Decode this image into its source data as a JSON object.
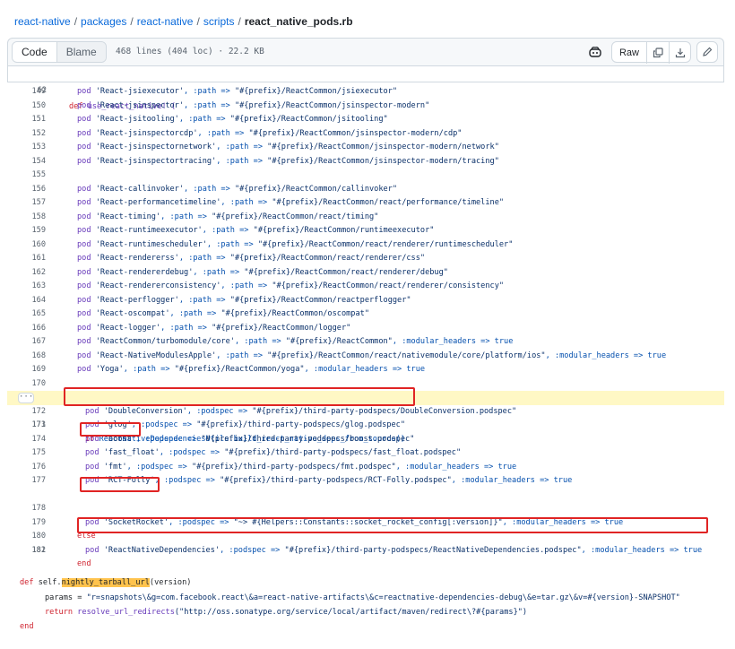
{
  "breadcrumb": {
    "repo": "react-native",
    "seg1": "packages",
    "seg2": "react-native",
    "seg3": "scripts",
    "file": "react_native_pods.rb",
    "separator": "/"
  },
  "toolbar": {
    "code_label": "Code",
    "blame_label": "Blame",
    "file_info": "468 lines (404 loc) · 22.2 KB",
    "raw_label": "Raw",
    "icons": [
      "copilot-icon",
      "copy-icon",
      "download-icon",
      "pencil-icon"
    ]
  },
  "sticky": {
    "num": "62",
    "kw": "def",
    "rest": " use_react_native! ("
  },
  "pods_a": [
    {
      "num": "149",
      "name": "'React-jsiexecutor'",
      "path": "\"#{prefix}/ReactCommon/jsiexecutor\""
    },
    {
      "num": "150",
      "name": "'React-jsinspector'",
      "path": "\"#{prefix}/ReactCommon/jsinspector-modern\""
    },
    {
      "num": "151",
      "name": "'React-jsitooling'",
      "path": "\"#{prefix}/ReactCommon/jsitooling\""
    },
    {
      "num": "152",
      "name": "'React-jsinspectorcdp'",
      "path": "\"#{prefix}/ReactCommon/jsinspector-modern/cdp\""
    },
    {
      "num": "153",
      "name": "'React-jsinspectornetwork'",
      "path": "\"#{prefix}/ReactCommon/jsinspector-modern/network\""
    },
    {
      "num": "154",
      "name": "'React-jsinspectortracing'",
      "path": "\"#{prefix}/ReactCommon/jsinspector-modern/tracing\""
    }
  ],
  "blank_155": "155",
  "pods_b": [
    {
      "num": "156",
      "name": "'React-callinvoker'",
      "path": "\"#{prefix}/ReactCommon/callinvoker\""
    },
    {
      "num": "157",
      "name": "'React-performancetimeline'",
      "path": "\"#{prefix}/ReactCommon/react/performance/timeline\""
    },
    {
      "num": "158",
      "name": "'React-timing'",
      "path": "\"#{prefix}/ReactCommon/react/timing\""
    },
    {
      "num": "159",
      "name": "'React-runtimeexecutor'",
      "path": "\"#{prefix}/ReactCommon/runtimeexecutor\""
    },
    {
      "num": "160",
      "name": "'React-runtimescheduler'",
      "path": "\"#{prefix}/ReactCommon/react/renderer/runtimescheduler\""
    },
    {
      "num": "161",
      "name": "'React-rendererss'",
      "path": "\"#{prefix}/ReactCommon/react/renderer/css\""
    },
    {
      "num": "162",
      "name": "'React-rendererdebug'",
      "path": "\"#{prefix}/ReactCommon/react/renderer/debug\""
    },
    {
      "num": "163",
      "name": "'React-rendererconsistency'",
      "path": "\"#{prefix}/ReactCommon/react/renderer/consistency\""
    },
    {
      "num": "164",
      "name": "'React-perflogger'",
      "path": "\"#{prefix}/ReactCommon/reactperflogger\""
    },
    {
      "num": "165",
      "name": "'React-oscompat'",
      "path": "\"#{prefix}/ReactCommon/oscompat\""
    },
    {
      "num": "166",
      "name": "'React-logger'",
      "path": "\"#{prefix}/ReactCommon/logger\""
    },
    {
      "num": "167",
      "name": "'ReactCommon/turbomodule/core'",
      "path": "\"#{prefix}/ReactCommon\"",
      "extra": ", :modular_headers => true"
    },
    {
      "num": "168",
      "name": "'React-NativeModulesApple'",
      "path": "\"#{prefix}/ReactCommon/react/nativemodule/core/platform/ios\"",
      "extra": ", :modular_headers => true"
    },
    {
      "num": "169",
      "name": "'Yoga'",
      "path": "\"#{prefix}/ReactCommon/yoga\"",
      "extra": ", :modular_headers => true"
    }
  ],
  "blank_170": "170",
  "line171": {
    "num": "171",
    "kw": "if",
    "code": " ReactNativeDependenciesUtils.build_react_native_deps_from_source()"
  },
  "pods_c": [
    {
      "num": "172",
      "name": "'DoubleConversion'",
      "path": "\"#{prefix}/third-party-podspecs/DoubleConversion.podspec\""
    },
    {
      "num": "173",
      "name": "'glog'",
      "path": "\"#{prefix}/third-party-podspecs/glog.podspec\""
    },
    {
      "num": "174",
      "name": "'boost'",
      "path": "\"#{prefix}/third-party-podspecs/boost.podspec\""
    },
    {
      "num": "175",
      "name": "'fast_float'",
      "path": "\"#{prefix}/third-party-podspecs/fast_float.podspec\""
    },
    {
      "num": "176",
      "name": "'fmt'",
      "path": "\"#{prefix}/third-party-podspecs/fmt.podspec\"",
      "extra": ", :modular_headers => true"
    },
    {
      "num": "177",
      "name": "'RCT-Folly'",
      "path": "\"#{prefix}/third-party-podspecs/RCT-Folly.podspec\"",
      "extra": ", :modular_headers => true"
    }
  ],
  "line178": {
    "num": "178",
    "name": "'SocketRocket'",
    "path": "\"~> #{Helpers::Constants::socket_rocket_config[:version]}\"",
    "extra": ", :modular_headers => true"
  },
  "line179": {
    "num": "179",
    "kw": "else"
  },
  "line180": {
    "num": "180",
    "name": "'ReactNativeDependencies'",
    "path": "\"#{prefix}/third-party-podspecs/ReactNativeDependencies.podspec\"",
    "extra": ", :modular_headers => true"
  },
  "line181": {
    "num": "181",
    "kw": "end"
  },
  "blank_182": "182",
  "tokens": {
    "pod": "pod",
    "path_key": ", :path => ",
    "podspec_key": ", :podspec => "
  },
  "tail": {
    "def": "def",
    "self": " self.",
    "method": "nightly_tarball_url",
    "args": "(version)",
    "params_var": "params = ",
    "params_str": "\"r=snapshots\\&g=com.facebook.react\\&a=react-native-artifacts\\&c=reactnative-dependencies-debug\\&e=tar.gz\\&v=#{version}-SNAPSHOT\"",
    "return_kw": "return",
    "return_fn": " resolve_url_redirects",
    "return_arg": "(\"http://oss.sonatype.org/service/local/artifact/maven/redirect\\?#{params}\")",
    "end_kw": "end"
  },
  "colors": {
    "link": "#0969da",
    "keyword": "#cf222e",
    "string": "#0a3069",
    "highlight_line": "#fff8c5",
    "annotation_box": "#e02424",
    "search_match": "#ffc34d"
  }
}
